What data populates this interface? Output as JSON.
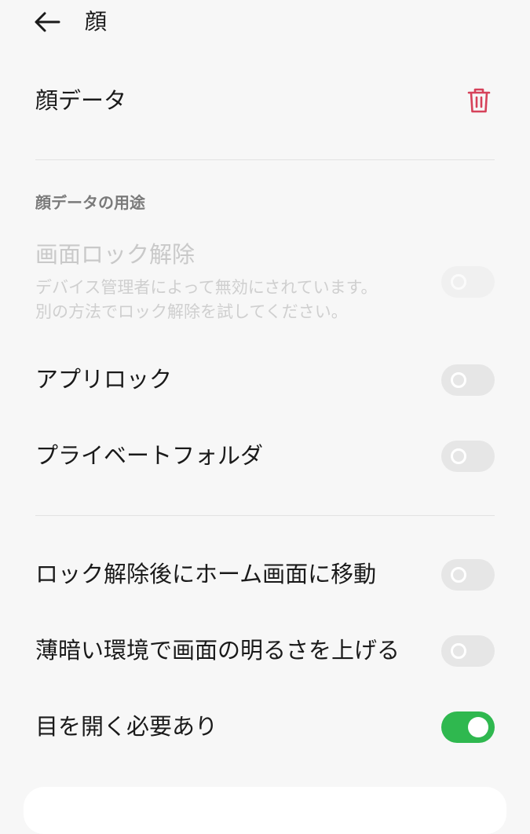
{
  "header": {
    "title": "顔"
  },
  "face_data": {
    "label": "顔データ"
  },
  "section": {
    "title": "顔データの用途"
  },
  "screen_unlock": {
    "title": "画面ロック解除",
    "subtitle_line1": "デバイス管理者によって無効にされています。",
    "subtitle_line2": "別の方法でロック解除を試してください。",
    "enabled": false,
    "disabled": true
  },
  "app_lock": {
    "title": "アプリロック",
    "enabled": false
  },
  "private_folder": {
    "title": "プライベートフォルダ",
    "enabled": false
  },
  "go_home": {
    "title": "ロック解除後にホーム画面に移動",
    "enabled": false
  },
  "brighten": {
    "title": "薄暗い環境で画面の明るさを上げる",
    "enabled": false
  },
  "eyes_open": {
    "title": "目を開く必要あり",
    "enabled": true
  },
  "colors": {
    "accent_on": "#2fb84f",
    "delete": "#d6425a"
  }
}
